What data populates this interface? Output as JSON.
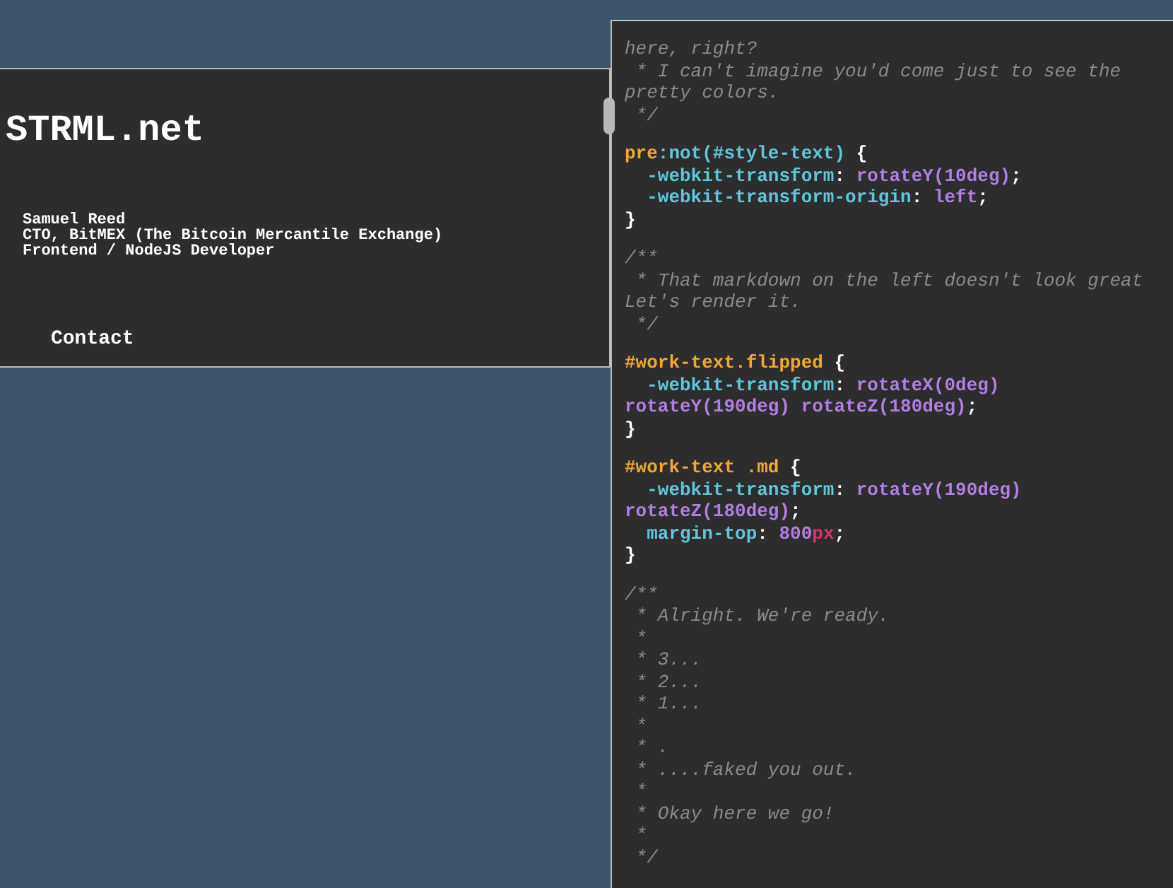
{
  "profile": {
    "title": "STRML.net",
    "lines": [
      "Samuel Reed",
      "CTO, BitMEX (The Bitcoin Mercantile Exchange)",
      "Frontend / NodeJS Developer"
    ],
    "link": "Contact"
  },
  "code_blocks": [
    [
      [
        {
          "kind": "comment",
          "text": "here, right?"
        }
      ],
      [
        {
          "kind": "comment",
          "text": " * I can't imagine you'd come just to see the"
        }
      ],
      [
        {
          "kind": "comment",
          "text": "pretty colors."
        }
      ],
      [
        {
          "kind": "comment",
          "text": " */"
        }
      ]
    ],
    [
      [
        {
          "kind": "selector",
          "text": "pre"
        },
        {
          "kind": "pseudo",
          "text": ":not(#style-text)"
        },
        {
          "kind": "punct",
          "text": " {"
        }
      ],
      [
        {
          "kind": "property",
          "text": "  -webkit-transform"
        },
        {
          "kind": "punct",
          "text": ": "
        },
        {
          "kind": "value",
          "text": "rotateY(10deg)"
        },
        {
          "kind": "punct",
          "text": ";"
        }
      ],
      [
        {
          "kind": "property",
          "text": "  -webkit-transform-origin"
        },
        {
          "kind": "punct",
          "text": ": "
        },
        {
          "kind": "value",
          "text": "left"
        },
        {
          "kind": "punct",
          "text": ";"
        }
      ],
      [
        {
          "kind": "punct",
          "text": "}"
        }
      ]
    ],
    [
      [
        {
          "kind": "comment",
          "text": "/**"
        }
      ],
      [
        {
          "kind": "comment",
          "text": " * That markdown on the left doesn't look great"
        }
      ],
      [
        {
          "kind": "comment",
          "text": "Let's render it."
        }
      ],
      [
        {
          "kind": "comment",
          "text": " */"
        }
      ]
    ],
    [
      [
        {
          "kind": "selector",
          "text": "#work-text.flipped"
        },
        {
          "kind": "punct",
          "text": " {"
        }
      ],
      [
        {
          "kind": "property",
          "text": "  -webkit-transform"
        },
        {
          "kind": "punct",
          "text": ": "
        },
        {
          "kind": "value",
          "text": "rotateX(0deg)"
        }
      ],
      [
        {
          "kind": "value",
          "text": "rotateY(190deg) rotateZ(180deg)"
        },
        {
          "kind": "punct",
          "text": ";"
        }
      ],
      [
        {
          "kind": "punct",
          "text": "}"
        }
      ]
    ],
    [
      [
        {
          "kind": "selector",
          "text": "#work-text .md"
        },
        {
          "kind": "punct",
          "text": " {"
        }
      ],
      [
        {
          "kind": "property",
          "text": "  -webkit-transform"
        },
        {
          "kind": "punct",
          "text": ": "
        },
        {
          "kind": "value",
          "text": "rotateY(190deg)"
        }
      ],
      [
        {
          "kind": "value",
          "text": "rotateZ(180deg)"
        },
        {
          "kind": "punct",
          "text": ";"
        }
      ],
      [
        {
          "kind": "property",
          "text": "  margin-top"
        },
        {
          "kind": "punct",
          "text": ": "
        },
        {
          "kind": "value",
          "text": "800"
        },
        {
          "kind": "unit",
          "text": "px"
        },
        {
          "kind": "punct",
          "text": ";"
        }
      ],
      [
        {
          "kind": "punct",
          "text": "}"
        }
      ]
    ],
    [
      [
        {
          "kind": "comment",
          "text": "/**"
        }
      ],
      [
        {
          "kind": "comment",
          "text": " * Alright. We're ready."
        }
      ],
      [
        {
          "kind": "comment",
          "text": " *"
        }
      ],
      [
        {
          "kind": "comment",
          "text": " * 3..."
        }
      ],
      [
        {
          "kind": "comment",
          "text": " * 2..."
        }
      ],
      [
        {
          "kind": "comment",
          "text": " * 1..."
        }
      ],
      [
        {
          "kind": "comment",
          "text": " *"
        }
      ],
      [
        {
          "kind": "comment",
          "text": " * ."
        }
      ],
      [
        {
          "kind": "comment",
          "text": " * ....faked you out."
        }
      ],
      [
        {
          "kind": "comment",
          "text": " *"
        }
      ],
      [
        {
          "kind": "comment",
          "text": " * Okay here we go!"
        }
      ],
      [
        {
          "kind": "comment",
          "text": " *"
        }
      ],
      [
        {
          "kind": "comment",
          "text": " */"
        }
      ]
    ]
  ]
}
